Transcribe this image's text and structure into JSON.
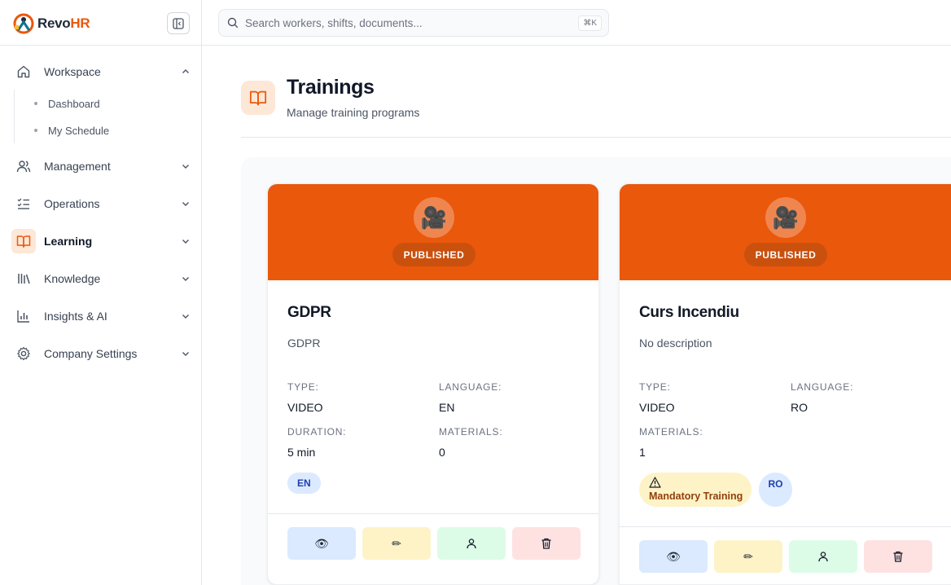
{
  "brand": {
    "name_part1": "Revo",
    "name_part2": "HR"
  },
  "search": {
    "placeholder": "Search workers, shifts, documents...",
    "shortcut": "⌘K"
  },
  "sidebar": {
    "sections": [
      {
        "label": "Workspace",
        "icon": "home-icon",
        "expanded": true
      },
      {
        "label": "Management",
        "icon": "users-icon"
      },
      {
        "label": "Operations",
        "icon": "checklist-icon"
      },
      {
        "label": "Learning",
        "icon": "book-icon",
        "active": true
      },
      {
        "label": "Knowledge",
        "icon": "library-icon"
      },
      {
        "label": "Insights & AI",
        "icon": "bar-chart-icon"
      },
      {
        "label": "Company Settings",
        "icon": "gear-icon"
      }
    ],
    "workspace_items": [
      "Dashboard",
      "My Schedule"
    ]
  },
  "page": {
    "title": "Trainings",
    "subtitle": "Manage training programs",
    "icon": "book-icon"
  },
  "trainings": [
    {
      "status": "PUBLISHED",
      "hero_icon": "movie-camera-icon",
      "title": "GDPR",
      "description": "GDPR",
      "type_label": "TYPE:",
      "type": "VIDEO",
      "language_label": "LANGUAGE:",
      "language": "EN",
      "duration_label": "DURATION:",
      "duration": "5 min",
      "materials_label": "MATERIALS:",
      "materials": "0",
      "language_badge": "EN"
    },
    {
      "status": "PUBLISHED",
      "hero_icon": "movie-camera-icon",
      "title": "Curs Incendiu",
      "description": "No description",
      "type_label": "TYPE:",
      "type": "VIDEO",
      "language_label": "LANGUAGE:",
      "language": "RO",
      "materials_label": "MATERIALS:",
      "materials": "1",
      "mandatory_badge": "Mandatory Training",
      "language_badge": "RO"
    }
  ],
  "colors": {
    "accent": "#ea580c",
    "accent_soft": "#fde7d6"
  }
}
